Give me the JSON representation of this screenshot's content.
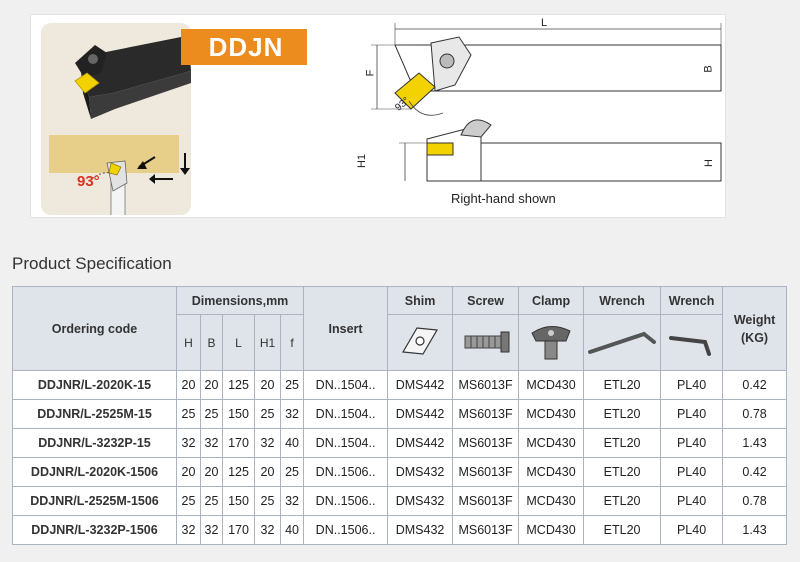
{
  "header": {
    "banner": "DDJN",
    "photo_angle": "93°",
    "drawing_angle": "93°",
    "caption": "Right-hand shown",
    "dim_labels": {
      "L": "L",
      "F": "F",
      "B": "B",
      "H1": "H1",
      "H": "H"
    }
  },
  "section_title": "Product Specification",
  "table": {
    "head": {
      "ordering_code": "Ordering code",
      "dimensions": "Dimensions,mm",
      "dim_cols": [
        "H",
        "B",
        "L",
        "H1",
        "f"
      ],
      "insert": "Insert",
      "shim": "Shim",
      "screw": "Screw",
      "clamp": "Clamp",
      "wrench1": "Wrench",
      "wrench2": "Wrench",
      "weight": "Weight",
      "weight_unit": "(KG)"
    },
    "icons": [
      "shim-icon",
      "screw-icon",
      "clamp-icon",
      "hex-key-wrench-icon",
      "l-wrench-icon"
    ],
    "rows": [
      [
        "DDJNR/L-2020K-15",
        "20",
        "20",
        "125",
        "20",
        "25",
        "DN..1504..",
        "DMS442",
        "MS6013F",
        "MCD430",
        "ETL20",
        "PL40",
        "0.42"
      ],
      [
        "DDJNR/L-2525M-15",
        "25",
        "25",
        "150",
        "25",
        "32",
        "DN..1504..",
        "DMS442",
        "MS6013F",
        "MCD430",
        "ETL20",
        "PL40",
        "0.78"
      ],
      [
        "DDJNR/L-3232P-15",
        "32",
        "32",
        "170",
        "32",
        "40",
        "DN..1504..",
        "DMS442",
        "MS6013F",
        "MCD430",
        "ETL20",
        "PL40",
        "1.43"
      ],
      [
        "DDJNR/L-2020K-1506",
        "20",
        "20",
        "125",
        "20",
        "25",
        "DN..1506..",
        "DMS432",
        "MS6013F",
        "MCD430",
        "ETL20",
        "PL40",
        "0.42"
      ],
      [
        "DDJNR/L-2525M-1506",
        "25",
        "25",
        "150",
        "25",
        "32",
        "DN..1506..",
        "DMS432",
        "MS6013F",
        "MCD430",
        "ETL20",
        "PL40",
        "0.78"
      ],
      [
        "DDJNR/L-3232P-1506",
        "32",
        "32",
        "170",
        "32",
        "40",
        "DN..1506..",
        "DMS432",
        "MS6013F",
        "MCD430",
        "ETL20",
        "PL40",
        "1.43"
      ]
    ]
  },
  "colors": {
    "banner": "#ec8b1e",
    "insert": "#f2d200",
    "table_header": "#dfe4ea",
    "grid": "#aab3bf"
  }
}
